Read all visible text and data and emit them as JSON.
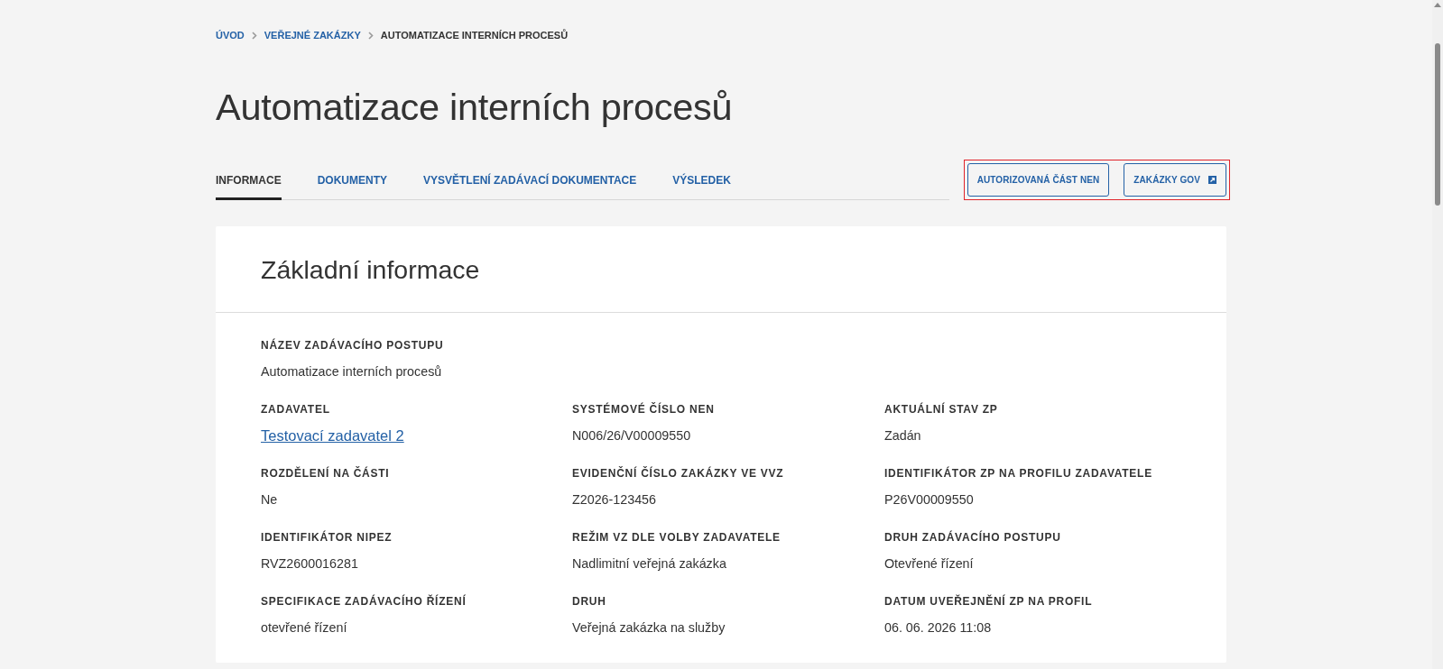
{
  "breadcrumb": [
    {
      "label": "ÚVOD",
      "link": true
    },
    {
      "label": "VEŘEJNÉ ZAKÁZKY",
      "link": true
    },
    {
      "label": "AUTOMATIZACE INTERNÍCH PROCESŮ",
      "link": false
    }
  ],
  "page_title": "Automatizace interních procesů",
  "tabs": [
    {
      "label": "INFORMACE",
      "selected": true
    },
    {
      "label": "DOKUMENTY",
      "selected": false
    },
    {
      "label": "VYSVĚTLENÍ ZADÁVACÍ DOKUMENTACE",
      "selected": false
    },
    {
      "label": "VÝSLEDEK",
      "selected": false
    }
  ],
  "action_buttons": {
    "highlighted": true,
    "items": [
      {
        "label": "AUTORIZOVANÁ ČÁST NEN",
        "external": false
      },
      {
        "label": "ZAKÁZKY GOV",
        "external": true
      }
    ]
  },
  "card": {
    "title": "Základní informace",
    "rows": [
      [
        {
          "label": "NÁZEV ZADÁVACÍHO POSTUPU",
          "value": "Automatizace interních procesů",
          "kind": "text"
        }
      ],
      [
        {
          "label": "ZADAVATEL",
          "value": "Testovací zadavatel 2",
          "kind": "link"
        },
        {
          "label": "SYSTÉMOVÉ ČÍSLO NEN",
          "value": "N006/26/V00009550",
          "kind": "text"
        },
        {
          "label": "AKTUÁLNÍ STAV ZP",
          "value": "Zadán",
          "kind": "text"
        }
      ],
      [
        {
          "label": "ROZDĚLENÍ NA ČÁSTI",
          "value": "Ne",
          "kind": "text"
        },
        {
          "label": "EVIDENČNÍ ČÍSLO ZAKÁZKY VE VVZ",
          "value": "Z2026-123456",
          "kind": "text"
        },
        {
          "label": "IDENTIFIKÁTOR ZP NA PROFILU ZADAVATELE",
          "value": "P26V00009550",
          "kind": "text"
        }
      ],
      [
        {
          "label": "IDENTIFIKÁTOR NIPEZ",
          "value": "RVZ2600016281",
          "kind": "text"
        },
        {
          "label": "REŽIM VZ DLE VOLBY ZADAVATELE",
          "value": "Nadlimitní veřejná zakázka",
          "kind": "text"
        },
        {
          "label": "DRUH ZADÁVACÍHO POSTUPU",
          "value": "Otevřené řízení",
          "kind": "text"
        }
      ],
      [
        {
          "label": "SPECIFIKACE ZADÁVACÍHO ŘÍZENÍ",
          "value": "otevřené řízení",
          "kind": "text"
        },
        {
          "label": "DRUH",
          "value": "Veřejná zakázka na služby",
          "kind": "text"
        },
        {
          "label": "DATUM UVEŘEJNĚNÍ ZP NA PROFIL",
          "value": "06. 06. 2026 11:08",
          "kind": "text"
        }
      ]
    ]
  }
}
